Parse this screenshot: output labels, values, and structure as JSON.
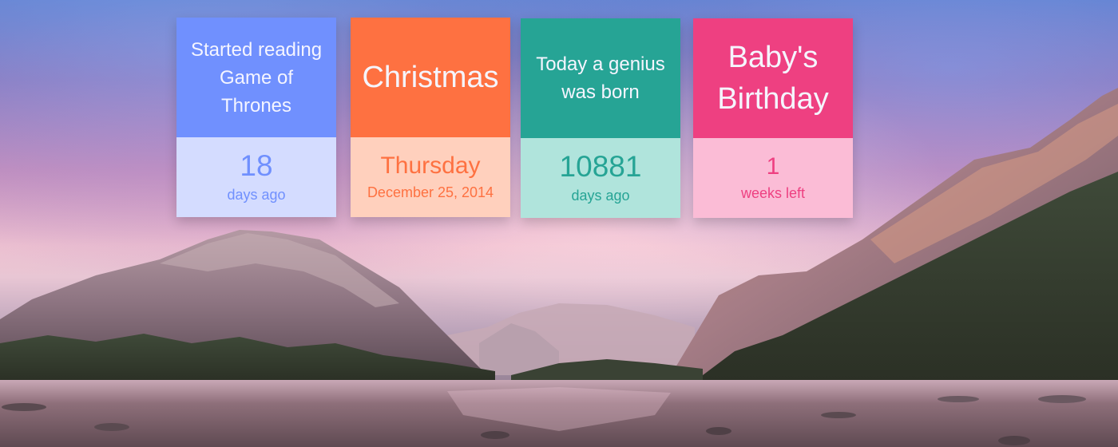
{
  "cards": [
    {
      "title": "Started reading Game of Thrones",
      "value": "18",
      "sub": "days ago",
      "accent": "#7090fe"
    },
    {
      "title": "Christmas",
      "value": "Thursday",
      "sub": "December 25, 2014",
      "accent": "#fe7141"
    },
    {
      "title": "Today a genius was born",
      "value": "10881",
      "sub": "days ago",
      "accent": "#26a495"
    },
    {
      "title": "Baby's Birthday",
      "value": "1",
      "sub": "weeks left",
      "accent": "#ee4081"
    }
  ]
}
